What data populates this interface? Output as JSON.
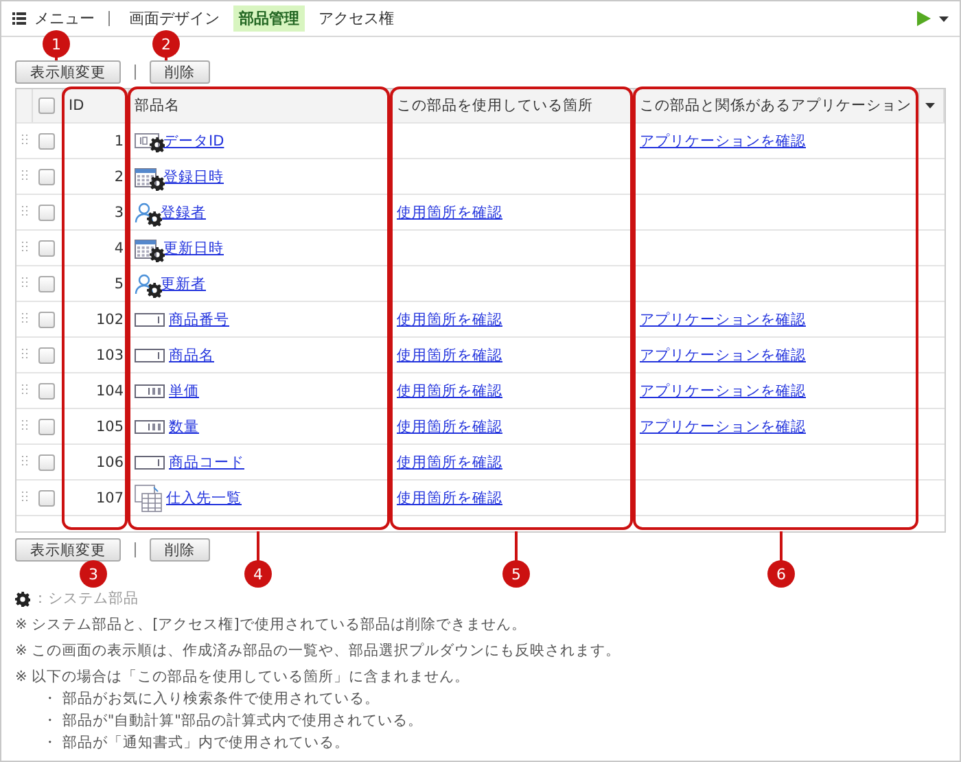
{
  "nav": {
    "menu": "メニュー",
    "tabs": [
      {
        "label": "画面デザイン",
        "selected": false
      },
      {
        "label": "部品管理",
        "selected": true
      },
      {
        "label": "アクセス権",
        "selected": false
      }
    ]
  },
  "toolbar": {
    "buttons": [
      "表示順変更",
      "削除"
    ]
  },
  "table": {
    "select_all_checked": false,
    "columns": [
      "ID",
      "部品名",
      "この部品を使用している箇所",
      "この部品と関係があるアプリケーション"
    ],
    "rows": [
      {
        "id": "1",
        "name": "データID",
        "kind": "id",
        "system": true,
        "checked": false,
        "usage": null,
        "app": "アプリケーションを確認"
      },
      {
        "id": "2",
        "name": "登録日時",
        "kind": "date",
        "system": true,
        "checked": false,
        "usage": null,
        "app": null
      },
      {
        "id": "3",
        "name": "登録者",
        "kind": "user",
        "system": true,
        "checked": false,
        "usage": "使用箇所を確認",
        "app": null
      },
      {
        "id": "4",
        "name": "更新日時",
        "kind": "date",
        "system": true,
        "checked": false,
        "usage": null,
        "app": null
      },
      {
        "id": "5",
        "name": "更新者",
        "kind": "user",
        "system": true,
        "checked": false,
        "usage": null,
        "app": null
      },
      {
        "id": "102",
        "name": "商品番号",
        "kind": "text",
        "system": false,
        "checked": false,
        "usage": "使用箇所を確認",
        "app": "アプリケーションを確認"
      },
      {
        "id": "103",
        "name": "商品名",
        "kind": "text",
        "system": false,
        "checked": false,
        "usage": "使用箇所を確認",
        "app": "アプリケーションを確認"
      },
      {
        "id": "104",
        "name": "単価",
        "kind": "number",
        "system": false,
        "checked": false,
        "usage": "使用箇所を確認",
        "app": "アプリケーションを確認"
      },
      {
        "id": "105",
        "name": "数量",
        "kind": "number",
        "system": false,
        "checked": false,
        "usage": "使用箇所を確認",
        "app": "アプリケーションを確認"
      },
      {
        "id": "106",
        "name": "商品コード",
        "kind": "text",
        "system": false,
        "checked": false,
        "usage": "使用箇所を確認",
        "app": null
      },
      {
        "id": "107",
        "name": "仕入先一覧",
        "kind": "table",
        "system": false,
        "checked": false,
        "usage": "使用箇所を確認",
        "app": null
      }
    ]
  },
  "bottom_buttons": [
    "表示順変更",
    "削除"
  ],
  "legend": "：システム部品",
  "notes": [
    "※ システム部品と、[アクセス権]で使用されている部品は削除できません。",
    "※ この画面の表示順は、作成済み部品の一覧や、部品選択プルダウンにも反映されます。",
    "※ 以下の場合は「この部品を使用している箇所」に含まれません。"
  ],
  "bullets": [
    "・ 部品がお気に入り検索条件で使用されている。",
    "・ 部品が\"自動計算\"部品の計算式内で使用されている。",
    "・ 部品が「通知書式」内で使用されている。"
  ],
  "callouts": [
    "1",
    "2",
    "3",
    "4",
    "5",
    "6"
  ]
}
